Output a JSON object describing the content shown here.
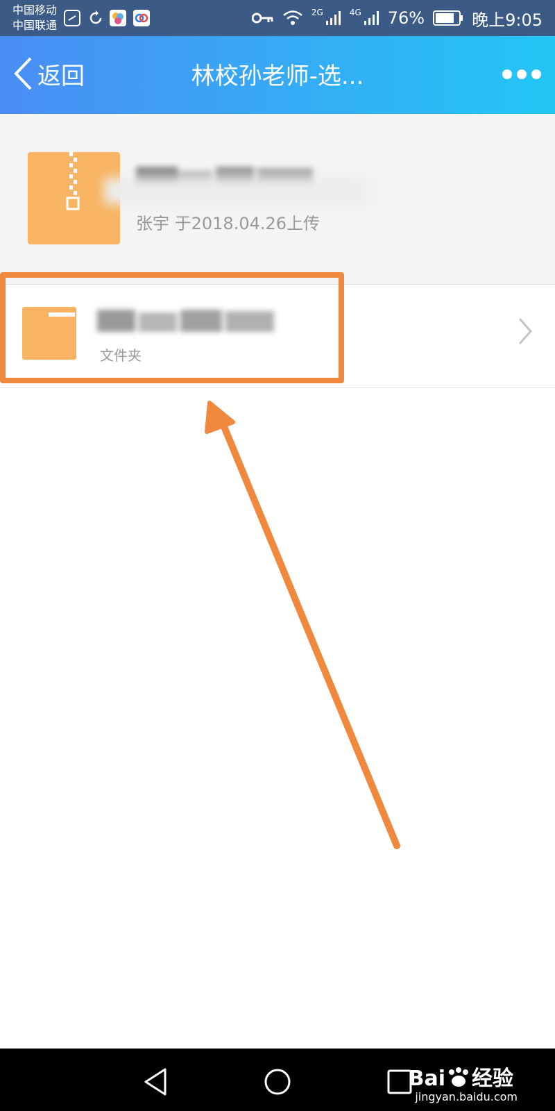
{
  "status_bar": {
    "carrier1": "中国移动",
    "carrier2": "中国联通",
    "network1": "2G",
    "network2": "4G",
    "battery": "76%",
    "time": "晚上9:05"
  },
  "nav": {
    "back_label": "返回",
    "title": "林校孙老师-选..."
  },
  "files": [
    {
      "type": "zip",
      "name": "",
      "meta": "张宇 于2018.04.26上传"
    },
    {
      "type": "folder",
      "name": "",
      "meta": "文件夹"
    }
  ],
  "watermark": {
    "brand": "Bai",
    "brand_suffix": "经验",
    "url": "jingyan.baidu.com"
  },
  "colors": {
    "nav_gradient_start": "#4a8df5",
    "nav_gradient_end": "#23c6f5",
    "file_icon": "#f8b462",
    "annotation": "#f0883e"
  }
}
